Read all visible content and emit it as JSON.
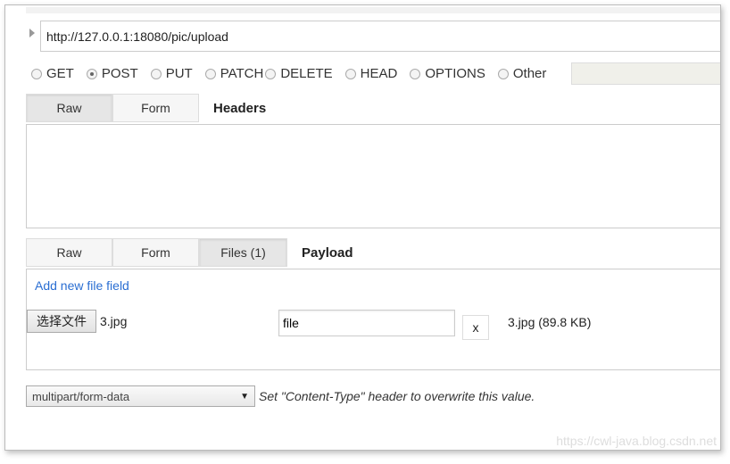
{
  "request": {
    "url": "http://127.0.0.1:18080/pic/upload",
    "methods": [
      {
        "label": "GET",
        "selected": false
      },
      {
        "label": "POST",
        "selected": true
      },
      {
        "label": "PUT",
        "selected": false
      },
      {
        "label": "PATCH",
        "selected": false
      },
      {
        "label": "DELETE",
        "selected": false
      },
      {
        "label": "HEAD",
        "selected": false
      },
      {
        "label": "OPTIONS",
        "selected": false
      },
      {
        "label": "Other",
        "selected": false
      }
    ],
    "other_value": ""
  },
  "headers": {
    "tabs": [
      "Raw",
      "Form"
    ],
    "active": "Raw",
    "label": "Headers",
    "value": ""
  },
  "payload": {
    "tabs": [
      "Raw",
      "Form",
      "Files (1)"
    ],
    "active": "Files (1)",
    "label": "Payload",
    "add_field": "Add new file field",
    "file": {
      "choose_label": "选择文件",
      "chosen": "3.jpg",
      "field_name": "file",
      "remove_label": "x",
      "info": "3.jpg (89.8 KB)"
    }
  },
  "content_type": {
    "value": "multipart/form-data",
    "hint": "Set \"Content-Type\" header to overwrite this value."
  },
  "watermark": "https://cwl-java.blog.csdn.net"
}
